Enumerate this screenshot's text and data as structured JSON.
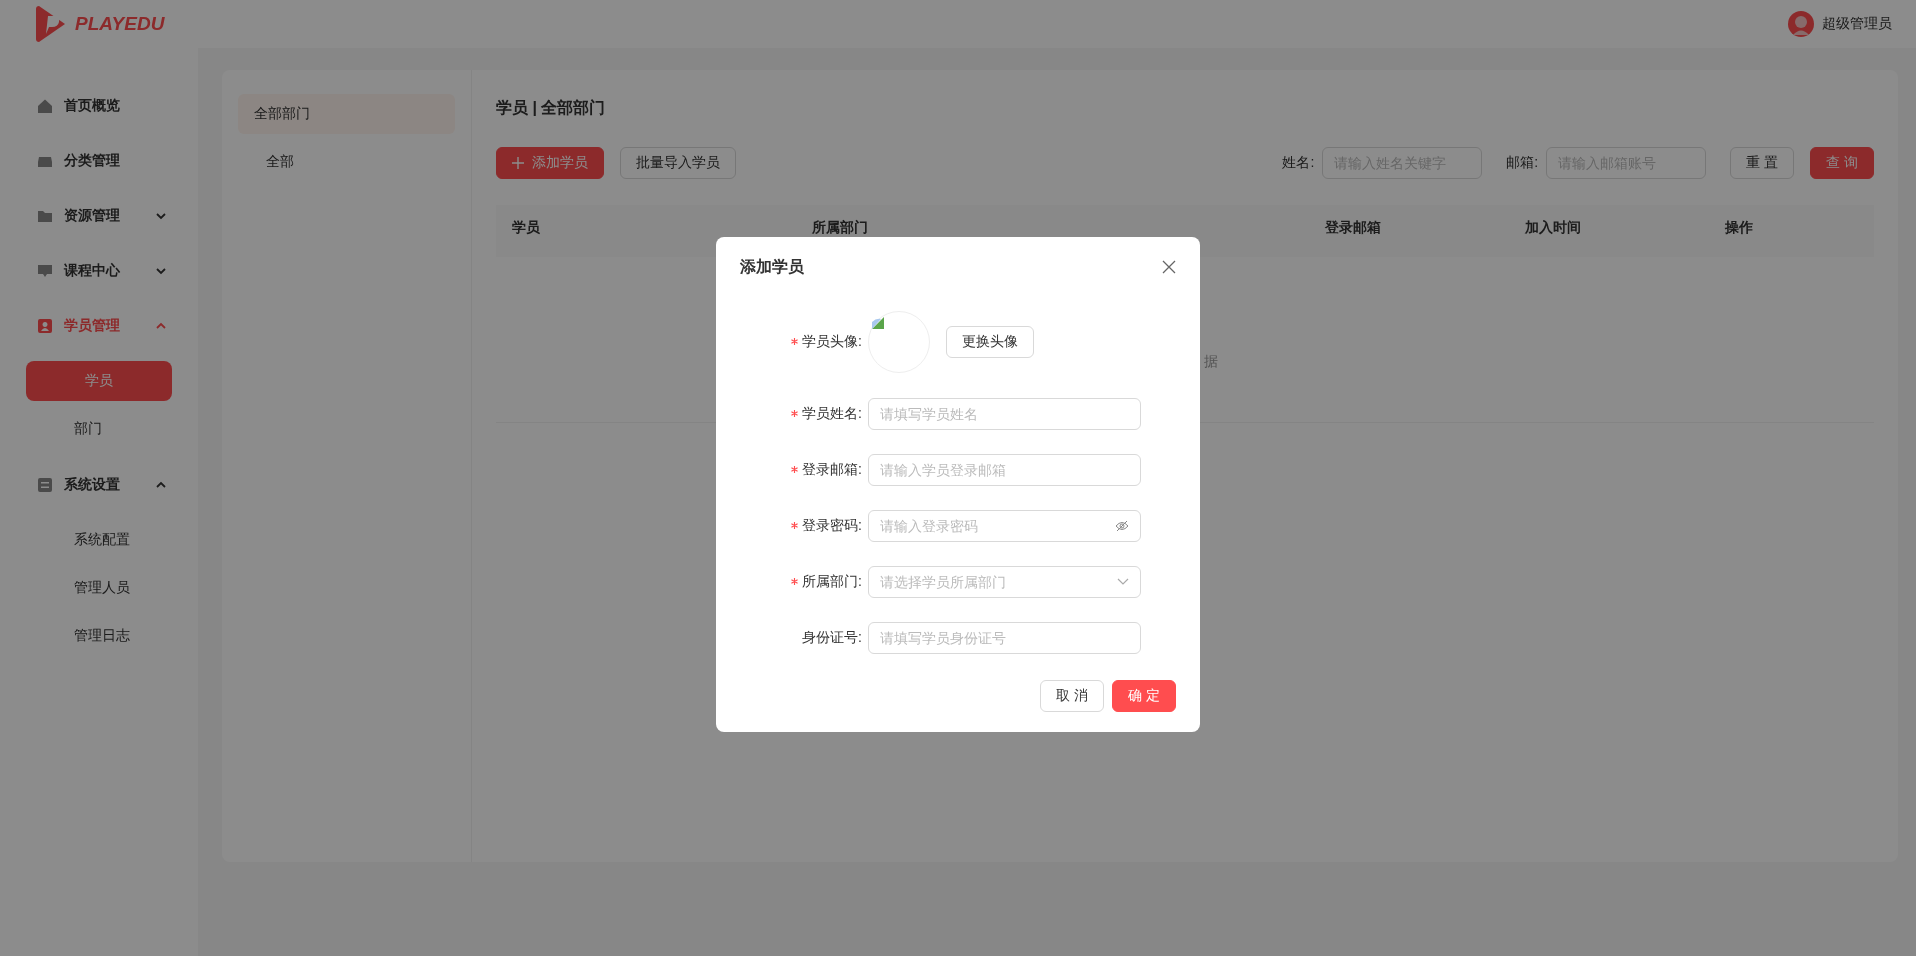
{
  "brand": {
    "name": "PLAYEDU"
  },
  "user": {
    "name": "超级管理员"
  },
  "sidebar": {
    "items": [
      {
        "label": "首页概览",
        "selected": false
      },
      {
        "label": "分类管理",
        "selected": false
      },
      {
        "label": "资源管理",
        "selected": false,
        "expanded": false
      },
      {
        "label": "课程中心",
        "selected": false,
        "expanded": false
      },
      {
        "label": "学员管理",
        "selected": true,
        "expanded": true,
        "children": [
          {
            "label": "学员",
            "selected": true
          },
          {
            "label": "部门",
            "selected": false
          }
        ]
      },
      {
        "label": "系统设置",
        "selected": false,
        "expanded": true,
        "children": [
          {
            "label": "系统配置",
            "selected": false
          },
          {
            "label": "管理人员",
            "selected": false
          },
          {
            "label": "管理日志",
            "selected": false
          }
        ]
      }
    ]
  },
  "departments": [
    {
      "label": "全部部门",
      "selected": true
    },
    {
      "label": "全部",
      "selected": false
    }
  ],
  "page_title": "学员 | 全部部门",
  "toolbar": {
    "add_button": "添加学员",
    "import_button": "批量导入学员",
    "filters": [
      {
        "label": "姓名:",
        "placeholder": "请输入姓名关键字"
      },
      {
        "label": "邮箱:",
        "placeholder": "请输入邮箱账号"
      }
    ],
    "reset_button": "重 置",
    "search_button": "查 询"
  },
  "table": {
    "columns": [
      "学员",
      "所属部门",
      "登录邮箱",
      "加入时间",
      "操作"
    ],
    "empty_text": "据"
  },
  "dialog": {
    "title": "添加学员",
    "fields": [
      {
        "kind": "avatar",
        "label": "学员头像:",
        "required": true,
        "button": "更换头像"
      },
      {
        "kind": "text",
        "label": "学员姓名:",
        "required": true,
        "placeholder": "请填写学员姓名"
      },
      {
        "kind": "text",
        "label": "登录邮箱:",
        "required": true,
        "placeholder": "请输入学员登录邮箱"
      },
      {
        "kind": "password",
        "label": "登录密码:",
        "required": true,
        "placeholder": "请输入登录密码"
      },
      {
        "kind": "select",
        "label": "所属部门:",
        "required": true,
        "placeholder": "请选择学员所属部门"
      },
      {
        "kind": "text",
        "label": "身份证号:",
        "required": false,
        "placeholder": "请填写学员身份证号"
      }
    ],
    "buttons": [
      {
        "label": "取 消",
        "primary": false
      },
      {
        "label": "确 定",
        "primary": true
      }
    ]
  }
}
